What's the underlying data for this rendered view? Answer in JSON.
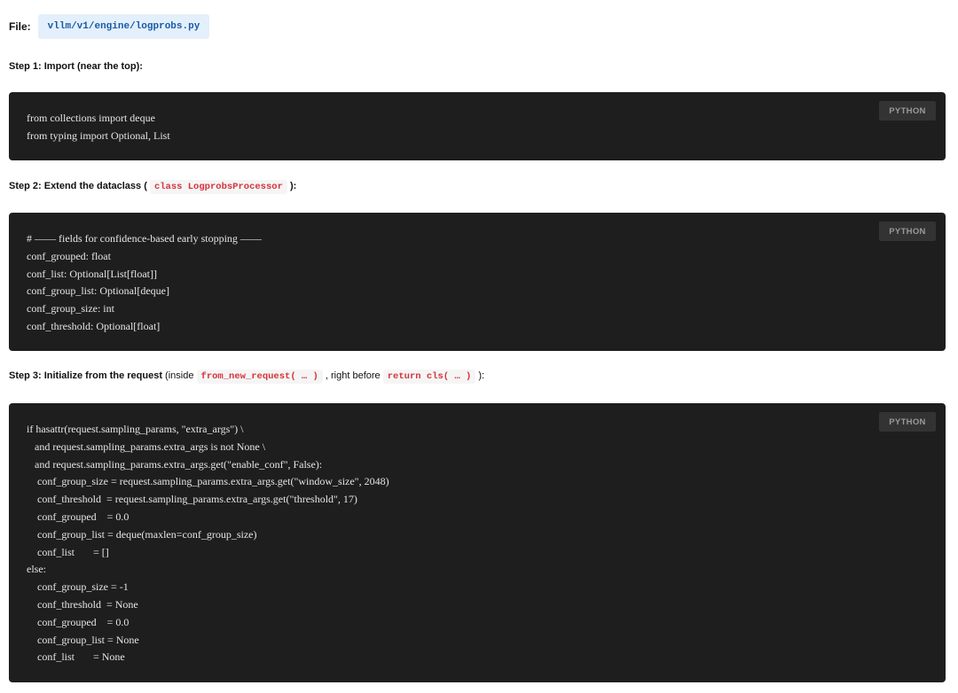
{
  "file": {
    "label": "File:",
    "path": "vllm/v1/engine/logprobs.py"
  },
  "steps": [
    {
      "title": "Step 1: Import (near the top):",
      "lang": "PYTHON",
      "code": [
        "from collections import deque",
        "from typing import Optional, List"
      ]
    },
    {
      "title_prefix": "Step 2: Extend the dataclass (",
      "title_code": "class LogprobsProcessor",
      "title_suffix": "):",
      "lang": "PYTHON",
      "code": [
        "# —— fields for confidence-based early stopping ——",
        "conf_grouped: float",
        "conf_list: Optional[List[float]]",
        "conf_group_list: Optional[deque]",
        "conf_group_size: int",
        "conf_threshold: Optional[float]"
      ]
    },
    {
      "title_bold": "Step 3: Initialize from the request",
      "title_text1": "(inside",
      "title_code1": "from_new_request( … )",
      "title_text2": ", right before",
      "title_code2": "return cls( … )",
      "title_text3": "):",
      "lang": "PYTHON",
      "code": [
        "if hasattr(request.sampling_params, \"extra_args\") \\",
        "   and request.sampling_params.extra_args is not None \\",
        "   and request.sampling_params.extra_args.get(\"enable_conf\", False):",
        "    conf_group_size = request.sampling_params.extra_args.get(\"window_size\", 2048)",
        "    conf_threshold  = request.sampling_params.extra_args.get(\"threshold\", 17)",
        "    conf_grouped    = 0.0",
        "    conf_group_list = deque(maxlen=conf_group_size)",
        "    conf_list       = []",
        "else:",
        "    conf_group_size = -1",
        "    conf_threshold  = None",
        "    conf_grouped    = 0.0",
        "    conf_group_list = None",
        "    conf_list       = None"
      ]
    }
  ]
}
